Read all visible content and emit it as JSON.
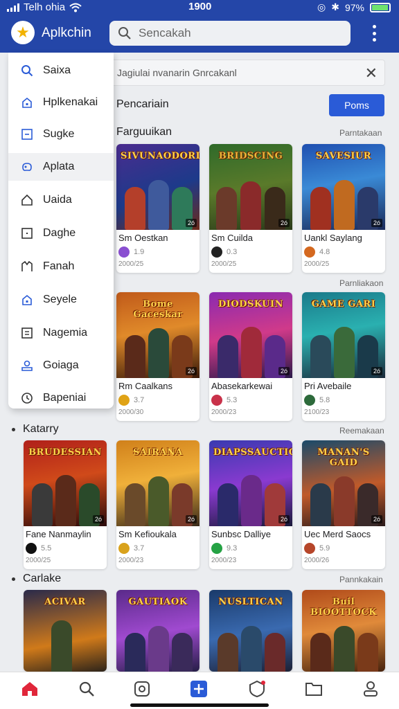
{
  "status": {
    "carrier": "Telh ohia",
    "time": "1900",
    "battery": "97%"
  },
  "header": {
    "app_title": "Aplkchin",
    "search_placeholder": "Sencakah"
  },
  "drawer": {
    "items": [
      {
        "label": "Saixa",
        "icon": "search-icon"
      },
      {
        "label": "Hplkenakai",
        "icon": "lock-icon"
      },
      {
        "label": "Sugke",
        "icon": "window-icon"
      },
      {
        "label": "Aplata",
        "icon": "gamepad-icon"
      },
      {
        "label": "Uaida",
        "icon": "home-icon"
      },
      {
        "label": "Daghe",
        "icon": "box-icon"
      },
      {
        "label": "Fanah",
        "icon": "book-icon"
      },
      {
        "label": "Seyele",
        "icon": "lock-icon"
      },
      {
        "label": "Nagemia",
        "icon": "document-icon"
      },
      {
        "label": "Goiaga",
        "icon": "user-icon"
      },
      {
        "label": "Bapeniai",
        "icon": "clock-icon"
      }
    ]
  },
  "filter": {
    "text": "Jagiulai nvanarin Gnrcakanl"
  },
  "pencarian": {
    "label": "Pencariain",
    "button": "Poms"
  },
  "sections": [
    {
      "title": "Farguuikan",
      "link": "Parntakaan",
      "cards": [
        {
          "art": "SIVUNAODORL",
          "name": "Sm Oestkan",
          "rating": "1.9",
          "date": "2000/25",
          "icon_color": "#8a4fd1"
        },
        {
          "art": "BRIDSCING",
          "name": "Sm Cuilda",
          "rating": "0.3",
          "date": "2000/25",
          "icon_color": "#222222"
        },
        {
          "art": "SAVESIUR",
          "name": "Uankl Saylang",
          "rating": "4.8",
          "date": "2000/25",
          "icon_color": "#d4681f"
        }
      ]
    },
    {
      "title": "",
      "link": "Parnliakaon",
      "cards": [
        {
          "art": "Bome  Gaceskar",
          "name": "Rm Caalkans",
          "rating": "3.7",
          "date": "2000/30",
          "icon_color": "#e0a316"
        },
        {
          "art": "DIODSKUIN",
          "name": "Abasekarkewai",
          "rating": "5.3",
          "date": "2000/23",
          "icon_color": "#c9324a"
        },
        {
          "art": "GAME GARI",
          "name": "Pri Avebaile",
          "rating": "5.8",
          "date": "2100/23",
          "icon_color": "#2d6a3b"
        }
      ]
    },
    {
      "title": "Katarry",
      "link": "Reemakaan",
      "cards": [
        {
          "art": "BRUDESSIAN",
          "name": "Fane Nanmaylin",
          "rating": "5.5",
          "date": "2000/25",
          "icon_color": "#111111"
        },
        {
          "art": "SAIRANA",
          "name": "Sm Kefioukala",
          "rating": "3.7",
          "date": "2000/23",
          "icon_color": "#d9a21c"
        },
        {
          "art": "DIAPSSAUCTION",
          "name": "Sunbsc Dalliye",
          "rating": "9.3",
          "date": "2000/23",
          "icon_color": "#25a244"
        },
        {
          "art": "MANAN'S GAID",
          "name": "Uec Merd Saocs",
          "rating": "5.9",
          "date": "2000/26",
          "icon_color": "#b6462a"
        }
      ]
    },
    {
      "title": "Carlake",
      "link": "Pannkakain",
      "cards": [
        {
          "art": "ACIVAR",
          "name": "",
          "rating": "",
          "date": "",
          "icon_color": "#333333"
        },
        {
          "art": "GAUTIAOK",
          "name": "",
          "rating": "",
          "date": "",
          "icon_color": "#333333"
        },
        {
          "art": "NUSLTICAN",
          "name": "",
          "rating": "",
          "date": "",
          "icon_color": "#333333"
        },
        {
          "art": "Buil  BIOOTTOCK",
          "name": "",
          "rating": "",
          "date": "",
          "icon_color": "#333333"
        }
      ]
    }
  ],
  "bottom_nav": [
    "home-icon",
    "search-icon",
    "gamepad-icon",
    "add-icon",
    "shield-icon",
    "folder-icon",
    "profile-icon"
  ],
  "colors": {
    "header": "#2446a8",
    "accent": "#2a5bd7",
    "home_active": "#e0263a"
  }
}
